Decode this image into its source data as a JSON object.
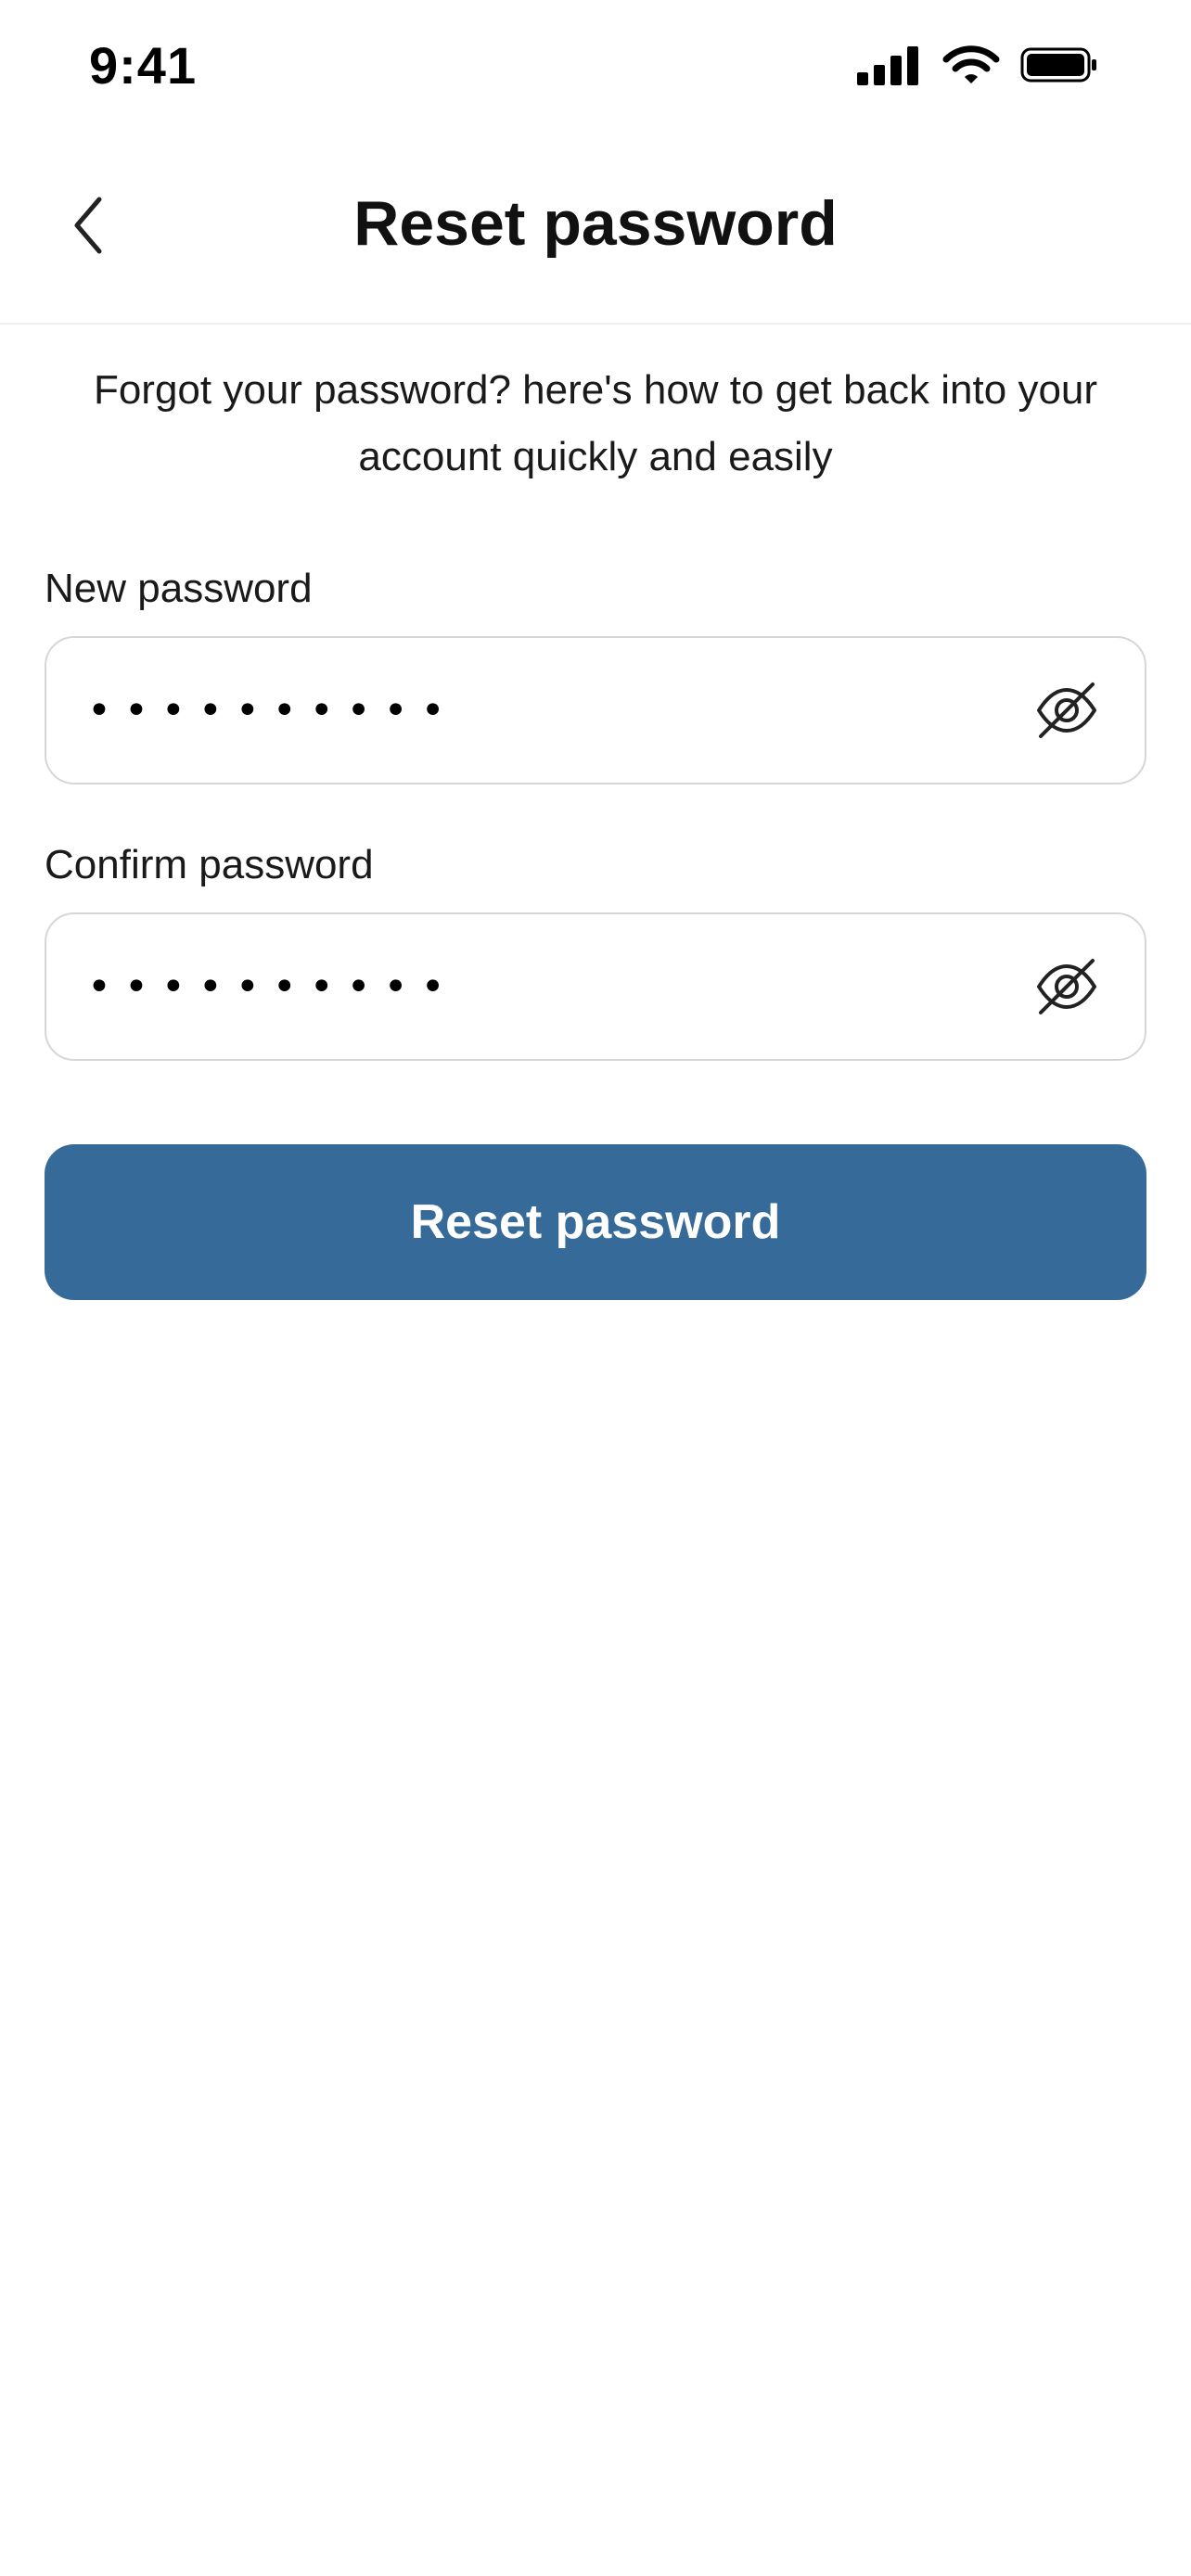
{
  "status_bar": {
    "time": "9:41",
    "icons": [
      "cellular-signal-icon",
      "wifi-icon",
      "battery-icon"
    ]
  },
  "header": {
    "back_icon": "chevron-left-icon",
    "title": "Reset password"
  },
  "intro_text": "Forgot your password? here's how to get back into your account quickly and easily",
  "form": {
    "new_password": {
      "label": "New password",
      "value": "••••••••••",
      "toggle_icon": "eye-off-icon"
    },
    "confirm_password": {
      "label": "Confirm password",
      "value": "••••••••••",
      "toggle_icon": "eye-off-icon"
    },
    "submit_label": "Reset password"
  },
  "colors": {
    "primary": "#366a98",
    "field_border": "#d6d6d6",
    "divider": "#eeeeee"
  }
}
